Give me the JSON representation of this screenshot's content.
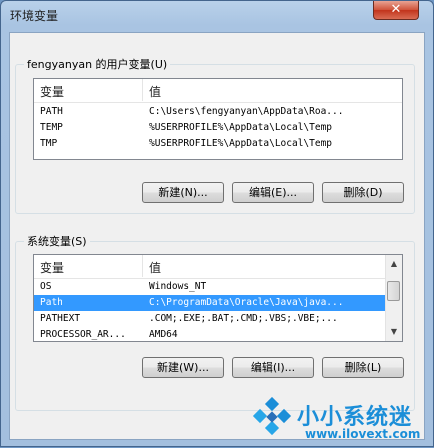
{
  "window": {
    "title": "环境变量",
    "close_glyph": "✕"
  },
  "user_vars": {
    "group_label": "fengyanyan 的用户变量(U)",
    "columns": [
      "变量",
      "值"
    ],
    "rows": [
      {
        "name": "PATH",
        "value": "C:\\Users\\fengyanyan\\AppData\\Roa..."
      },
      {
        "name": "TEMP",
        "value": "%USERPROFILE%\\AppData\\Local\\Temp"
      },
      {
        "name": "TMP",
        "value": "%USERPROFILE%\\AppData\\Local\\Temp"
      }
    ],
    "buttons": {
      "new": "新建(N)...",
      "edit": "编辑(E)...",
      "delete": "删除(D)"
    }
  },
  "sys_vars": {
    "group_label": "系统变量(S)",
    "columns": [
      "变量",
      "值"
    ],
    "rows": [
      {
        "name": "OS",
        "value": "Windows_NT"
      },
      {
        "name": "Path",
        "value": "C:\\ProgramData\\Oracle\\Java\\java..."
      },
      {
        "name": "PATHEXT",
        "value": ".COM;.EXE;.BAT;.CMD;.VBS;.VBE;..."
      },
      {
        "name": "PROCESSOR_AR...",
        "value": "AMD64"
      }
    ],
    "selected_row": 1,
    "buttons": {
      "new": "新建(W)...",
      "edit": "编辑(I)...",
      "delete": "删除(L)"
    }
  },
  "watermark": {
    "name": "小小系统迷",
    "url": "www.ilovext.com"
  },
  "colors": {
    "selection": "#3399ff",
    "watermark": "#1b8ed8"
  }
}
